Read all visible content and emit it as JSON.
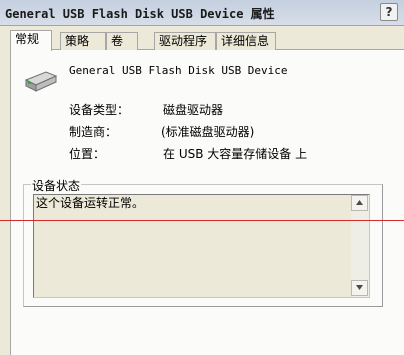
{
  "window": {
    "title": "General USB Flash Disk USB Device 属性",
    "help_symbol": "?"
  },
  "tabs": [
    {
      "label": "常规",
      "active": true
    },
    {
      "label": "策略",
      "active": false
    },
    {
      "label": "卷",
      "active": false
    },
    {
      "label": "驱动程序",
      "active": false
    },
    {
      "label": "详细信息",
      "active": false
    }
  ],
  "device": {
    "icon": "usb-drive-icon",
    "name": "General USB Flash Disk USB Device"
  },
  "properties": {
    "type_label": "设备类型：",
    "type_value": "磁盘驱动器",
    "maker_label": "制造商：",
    "maker_value": "(标准磁盘驱动器)",
    "location_label": "位置：",
    "location_value": "在 USB 大容量存储设备 上"
  },
  "status": {
    "legend": "设备状态",
    "text": "这个设备运转正常。"
  },
  "colors": {
    "dialog_bg": "#ece9d8",
    "panel_bg": "#fbfbf9",
    "annotation_line": "#d42c2c"
  }
}
